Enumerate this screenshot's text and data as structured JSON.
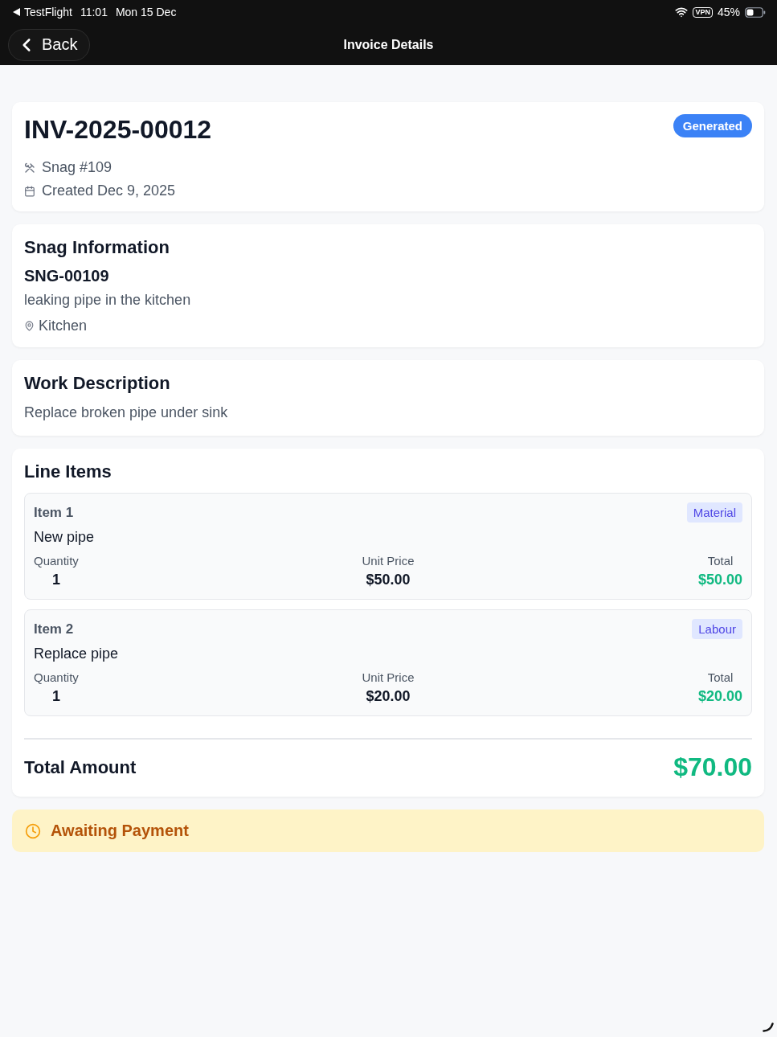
{
  "status_bar": {
    "app": "TestFlight",
    "time": "11:01",
    "date": "Mon 15 Dec",
    "vpn": "VPN",
    "battery": "45%"
  },
  "nav": {
    "back_label": "Back",
    "title": "Invoice Details"
  },
  "invoice": {
    "number": "INV-2025-00012",
    "status": "Generated",
    "meta": [
      {
        "kind": "snag",
        "text": "Snag #109"
      },
      {
        "kind": "created",
        "text": "Created Dec 9, 2025"
      }
    ]
  },
  "snag_information": {
    "title": "Snag Information",
    "code": "SNG-00109",
    "description": "leaking pipe in the kitchen",
    "location": "Kitchen"
  },
  "work_description": {
    "title": "Work Description",
    "text": "Replace broken pipe under sink"
  },
  "line_items": {
    "title": "Line Items",
    "items": [
      {
        "label": "Item 1",
        "type": "Material",
        "description": "New pipe",
        "quantity_label": "Quantity",
        "quantity": "1",
        "unit_price_label": "Unit Price",
        "unit_price": "$50.00",
        "total_label": "Total",
        "total": "$50.00"
      },
      {
        "label": "Item 2",
        "type": "Labour",
        "description": "Replace pipe",
        "quantity_label": "Quantity",
        "quantity": "1",
        "unit_price_label": "Unit Price",
        "unit_price": "$20.00",
        "total_label": "Total",
        "total": "$20.00"
      }
    ],
    "total_label": "Total Amount",
    "total": "$70.00"
  },
  "payment_status": {
    "kind": "awaiting",
    "label": "Awaiting Payment"
  }
}
